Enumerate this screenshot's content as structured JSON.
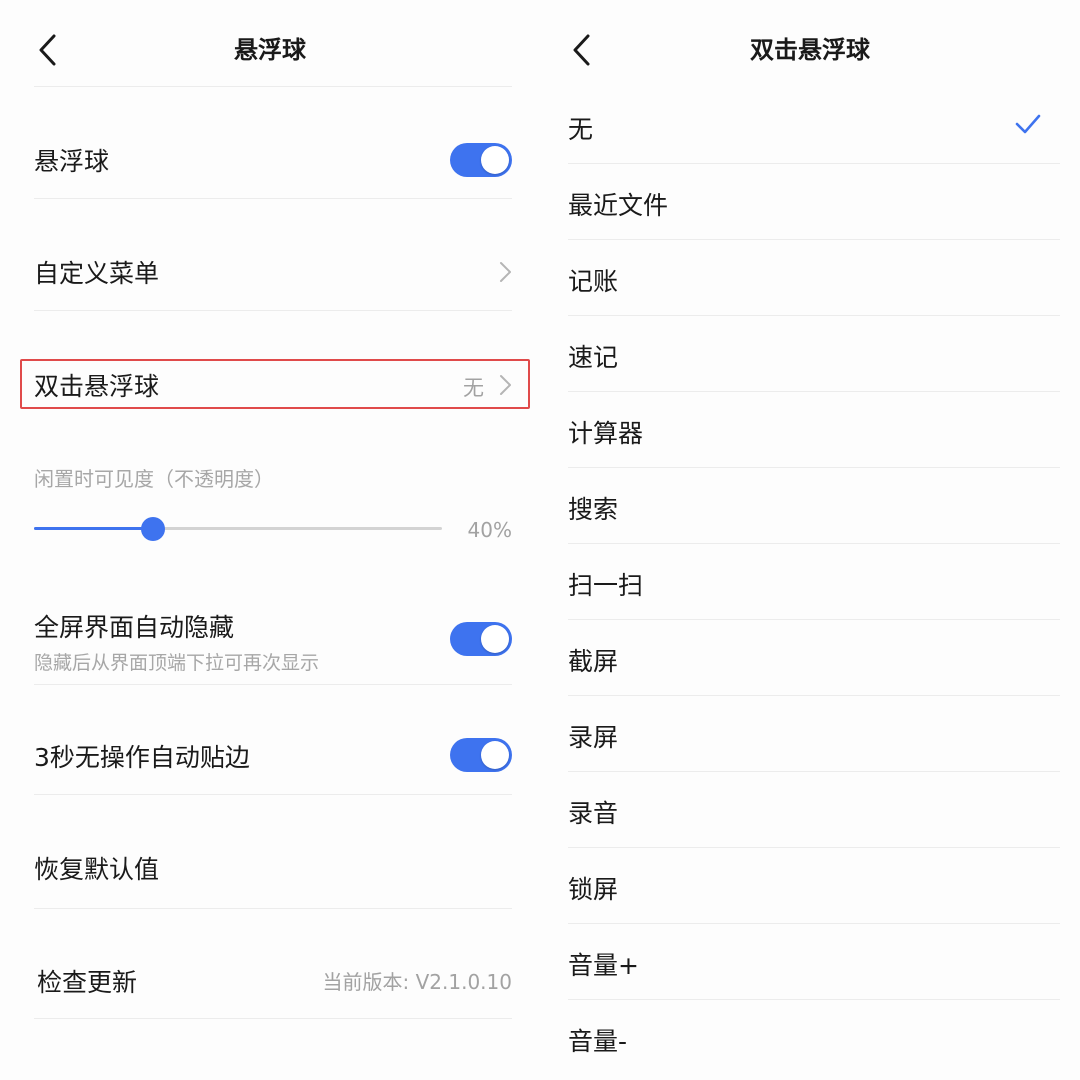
{
  "colors": {
    "accent": "#3e73ef",
    "highlight_border": "#e04a4a",
    "secondary_text": "#a2a2a2"
  },
  "left": {
    "title": "悬浮球",
    "back_icon": "chevron-left-icon",
    "rows": {
      "float_ball": {
        "label": "悬浮球",
        "enabled": true
      },
      "custom_menu": {
        "label": "自定义菜单",
        "icon": "chevron-right-icon"
      },
      "double_tap": {
        "label": "双击悬浮球",
        "value": "无",
        "icon": "chevron-right-icon"
      },
      "idle_visibility": {
        "label": "闲置时可见度（不透明度）",
        "value_text": "40%",
        "value": 0.4
      },
      "fullscreen_hide": {
        "label": "全屏界面自动隐藏",
        "sub": "隐藏后从界面顶端下拉可再次显示",
        "enabled": true
      },
      "auto_edge": {
        "label": "3秒无操作自动贴边",
        "enabled": true
      },
      "restore_default": {
        "label": "恢复默认值"
      },
      "check_update": {
        "label": "检查更新",
        "value": "当前版本: V2.1.0.10"
      }
    }
  },
  "right": {
    "title": "双击悬浮球",
    "back_icon": "chevron-left-icon",
    "selected_icon": "checkmark-icon",
    "options": [
      "无",
      "最近文件",
      "记账",
      "速记",
      "计算器",
      "搜索",
      "扫一扫",
      "截屏",
      "录屏",
      "录音",
      "锁屏",
      "音量+",
      "音量-"
    ],
    "selected_index": 0
  }
}
